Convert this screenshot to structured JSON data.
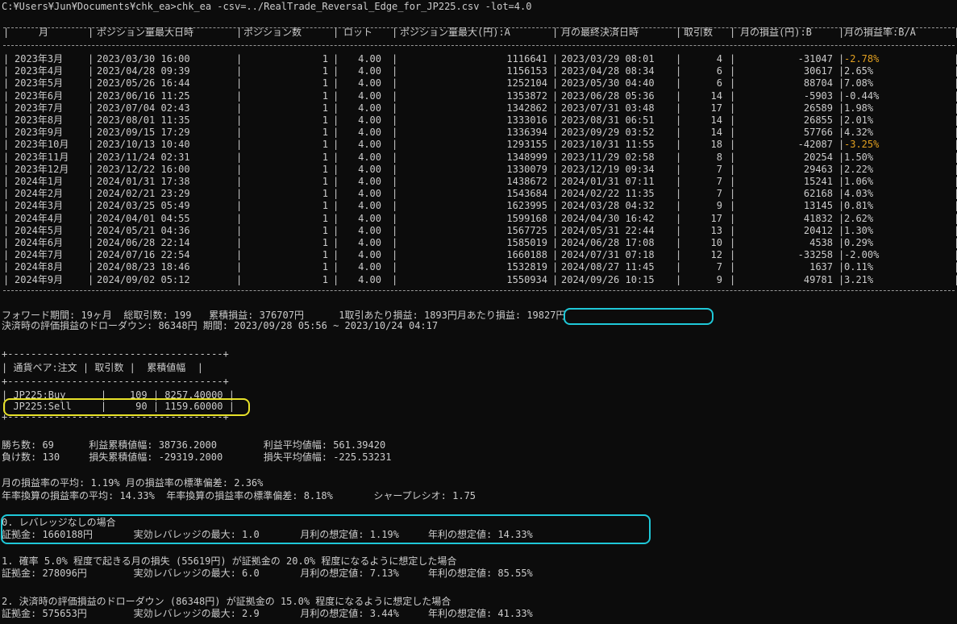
{
  "command": "C:¥Users¥Jun¥Documents¥chk_ea>chk_ea -csv=../RealTrade_Reversal_Edge_for_JP225.csv -lot=4.0",
  "monthly_table": {
    "headers": [
      "月",
      "ポジション量最大日時",
      "ポジション数",
      "ロット",
      "ポジション量最大(円):A",
      "月の最終決済日時",
      "取引数",
      "月の損益(円):B",
      "月の損益率:B/A"
    ],
    "rows": [
      [
        "2023年3月",
        "2023/03/30 16:00",
        "1",
        "4.00",
        "1116641",
        "2023/03/29 08:01",
        "4",
        "-31047",
        "-2.78%"
      ],
      [
        "2023年4月",
        "2023/04/28 09:39",
        "1",
        "4.00",
        "1156153",
        "2023/04/28 08:34",
        "6",
        "30617",
        "2.65%"
      ],
      [
        "2023年5月",
        "2023/05/26 16:44",
        "1",
        "4.00",
        "1252104",
        "2023/05/30 04:40",
        "6",
        "88704",
        "7.08%"
      ],
      [
        "2023年6月",
        "2023/06/16 11:25",
        "1",
        "4.00",
        "1353872",
        "2023/06/28 05:36",
        "14",
        "-5903",
        "-0.44%"
      ],
      [
        "2023年7月",
        "2023/07/04 02:43",
        "1",
        "4.00",
        "1342862",
        "2023/07/31 03:48",
        "17",
        "26589",
        "1.98%"
      ],
      [
        "2023年8月",
        "2023/08/01 11:35",
        "1",
        "4.00",
        "1333016",
        "2023/08/31 06:51",
        "14",
        "26855",
        "2.01%"
      ],
      [
        "2023年9月",
        "2023/09/15 17:29",
        "1",
        "4.00",
        "1336394",
        "2023/09/29 03:52",
        "14",
        "57766",
        "4.32%"
      ],
      [
        "2023年10月",
        "2023/10/13 10:40",
        "1",
        "4.00",
        "1293155",
        "2023/10/31 11:55",
        "18",
        "-42087",
        "-3.25%"
      ],
      [
        "2023年11月",
        "2023/11/24 02:31",
        "1",
        "4.00",
        "1348999",
        "2023/11/29 02:58",
        "8",
        "20254",
        "1.50%"
      ],
      [
        "2023年12月",
        "2023/12/22 16:00",
        "1",
        "4.00",
        "1330079",
        "2023/12/19 09:34",
        "7",
        "29463",
        "2.22%"
      ],
      [
        "2024年1月",
        "2024/01/31 17:38",
        "1",
        "4.00",
        "1438672",
        "2024/01/31 07:11",
        "7",
        "15241",
        "1.06%"
      ],
      [
        "2024年2月",
        "2024/02/21 23:29",
        "1",
        "4.00",
        "1543684",
        "2024/02/22 11:35",
        "7",
        "62168",
        "4.03%"
      ],
      [
        "2024年3月",
        "2024/03/25 05:49",
        "1",
        "4.00",
        "1623995",
        "2024/03/28 04:32",
        "9",
        "13145",
        "0.81%"
      ],
      [
        "2024年4月",
        "2024/04/01 04:55",
        "1",
        "4.00",
        "1599168",
        "2024/04/30 16:42",
        "17",
        "41832",
        "2.62%"
      ],
      [
        "2024年5月",
        "2024/05/21 04:36",
        "1",
        "4.00",
        "1567725",
        "2024/05/31 22:44",
        "13",
        "20412",
        "1.30%"
      ],
      [
        "2024年6月",
        "2024/06/28 22:14",
        "1",
        "4.00",
        "1585019",
        "2024/06/28 17:08",
        "10",
        "4538",
        "0.29%"
      ],
      [
        "2024年7月",
        "2024/07/16 22:54",
        "1",
        "4.00",
        "1660188",
        "2024/07/31 07:18",
        "12",
        "-33258",
        "-2.00%"
      ],
      [
        "2024年8月",
        "2024/08/23 18:46",
        "1",
        "4.00",
        "1532819",
        "2024/08/27 11:45",
        "7",
        "1637",
        "0.11%"
      ],
      [
        "2024年9月",
        "2024/09/02 05:12",
        "1",
        "4.00",
        "1550934",
        "2024/09/26 10:15",
        "9",
        "49781",
        "3.21%"
      ]
    ],
    "negative_color": "#e2a020"
  },
  "summary": {
    "line1": "フォワード期間: 19ヶ月  総取引数: 199   累積損益: 376707円      1取引あたり損益: 1893円",
    "monthly_profit": "月あたり損益: 19827円",
    "line2": "決済時の評価損益のドローダウン: 86348円 期間: 2023/09/28 05:56 ~ 2023/10/24 04:17"
  },
  "pair_table": {
    "border_top": "+-------------------------------------+",
    "header": "| 通貨ペア:注文 | 取引数 |  累積値幅  |",
    "border_mid": "+-------------------------------------+",
    "row1": "| JP225:Buy      |    109 | 8257.40000 |",
    "row2": "| JP225:Sell     |     90 | 1159.60000 |",
    "border_bottom": "+-------------------------------------+"
  },
  "stats": {
    "wins": "勝ち数: 69      利益累積値幅: 38736.2000        利益平均値幅: 561.39420",
    "losses": "負け数: 130     損失累積値幅: -29319.2000       損失平均値幅: -225.53231",
    "monthly_avg": "月の損益率の平均: 1.19% 月の損益率の標準偏差: 2.36%",
    "annual_avg": "年率換算の損益率の平均: 14.33%  年率換算の損益率の標準偏差: 8.18%       シャープレシオ: 1.75"
  },
  "scenarios": [
    {
      "title": "0. レバレッジなしの場合",
      "detail": "証拠金: 1660188円       実効レバレッジの最大: 1.0       月利の想定値: 1.19%     年利の想定値: 14.33%"
    },
    {
      "title": "1. 確率 5.0% 程度で起きる月の損失 (55619円) が証拠金の 20.0% 程度になるように想定した場合",
      "detail": "証拠金: 278096円        実効レバレッジの最大: 6.0       月利の想定値: 7.13%     年利の想定値: 85.55%"
    },
    {
      "title": "2. 決済時の評価損益のドローダウン (86348円) が証拠金の 15.0% 程度になるように想定した場合",
      "detail": "証拠金: 575653円        実効レバレッジの最大: 2.9       月利の想定値: 3.44%     年利の想定値: 41.33%"
    }
  ]
}
